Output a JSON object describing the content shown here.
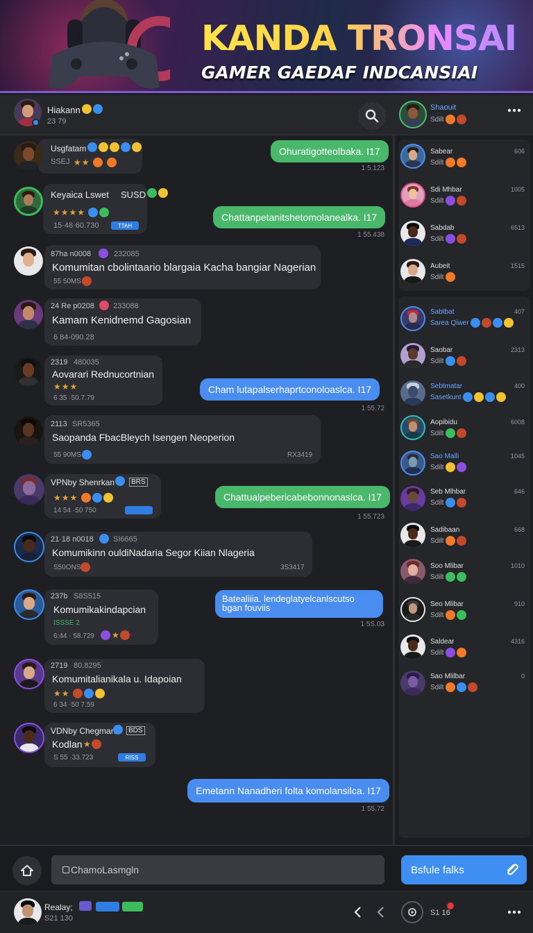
{
  "banner": {
    "title": "KANDA TRONSAI",
    "subtitle": "GAMER GAEDAF INDCANSIAI"
  },
  "topbar": {
    "user_name": "Hiakann",
    "user_meta": "23 79",
    "search_icon": "search-icon",
    "panel_user_name": "Shaouit",
    "panel_user_sub": "Sdilt",
    "more_icon": "more-icon"
  },
  "messages": [
    {
      "name": "Usgfatam",
      "meta": "SSEJ",
      "stars": "★★",
      "kind": "in"
    },
    {
      "text": "Ohuratigotteolbaka. I17",
      "time": "1 5.123",
      "kind": "out",
      "color": "green"
    },
    {
      "name": "Keyaica Lswet",
      "tag": "SUSD",
      "stars": "★★★★",
      "time": "15·48·60.730",
      "badge": "TTAH",
      "kind": "in"
    },
    {
      "text": "Chattanpetanitshetomolanealka. I17",
      "time": "1 55.438",
      "kind": "out",
      "color": "green"
    },
    {
      "name": "87ha n0008",
      "num": "232085",
      "text": "Komumitan cbolintaario blargaia Kacha bangiar Nagerian",
      "meta": "55 50MS",
      "kind": "in"
    },
    {
      "name": "24 Re p0208",
      "num": "233088",
      "text": "Kamam Kenidnemd Gagosian",
      "meta": "6 84-090.28",
      "kind": "in"
    },
    {
      "name": "2319",
      "num": "480035",
      "text": "Aovarari Rednucortnian",
      "stars": "★★★",
      "time": "6 35 ·50.7.79",
      "kind": "in"
    },
    {
      "text": "Cham lutapalserhaprtconoloaslca. I17",
      "time": "1 55.72",
      "kind": "out",
      "color": "blue"
    },
    {
      "name": "2113",
      "num": "SR5365",
      "text": "Saopanda FbacBleych Isengen Neoperion",
      "meta": "55 90MS",
      "meta_r": "RX3419",
      "kind": "in"
    },
    {
      "name": "VPNby Shenrkan",
      "tag": "BRS",
      "stars": "★★★",
      "time": "14 54 ·50 750",
      "kind": "in"
    },
    {
      "text": "Chattualpebericabebonnonaslca. I17",
      "time": "1 55.723",
      "kind": "out",
      "color": "green"
    },
    {
      "name": "21·18 n0018",
      "num": "SI6665",
      "text": "Komumikinn ouldiNadaria Segor Kiian Nlageria",
      "meta": "S50ONS",
      "meta_r": "3S3417",
      "kind": "in"
    },
    {
      "name": "237b",
      "num": "S8S515",
      "text": "Komumikakindapcian",
      "meta": "ISSSE 2",
      "time": "6:44 · 58.729",
      "kind": "in"
    },
    {
      "text": "Batealiiia. lendeglatyelcanlscutso",
      "text2": "bgan fouviis",
      "time": "1 5S.03",
      "kind": "out",
      "color": "blue"
    },
    {
      "name": "2719",
      "num": "80.8295",
      "text": "Komumitalianikala u. Idapoian",
      "stars": "★★",
      "time": "6 34 ·50 7.59",
      "kind": "in"
    },
    {
      "name": "VDNby Chegman",
      "tag": "BDS",
      "text": "Kodlan",
      "time": "S 55 ·33.723",
      "badge": "RISS",
      "kind": "in"
    },
    {
      "text": "Emetann Nanadheri folta komolansilca. I17",
      "time": "1 55.72",
      "kind": "out",
      "color": "blue"
    }
  ],
  "panel": [
    {
      "name": "Sabear",
      "sub": "Sdilt",
      "num": "606"
    },
    {
      "name": "Sdi Mhbar",
      "sub": "Sdilt",
      "num": "1005"
    },
    {
      "name": "Sabdab",
      "sub": "Sdilt",
      "num": "6513"
    },
    {
      "name": "Aubeit",
      "sub": "Sdilt",
      "num": "1515"
    },
    {
      "name": "Sabtbat",
      "sub": "Sarea Qiwer",
      "num": "407"
    },
    {
      "name": "Saobar",
      "sub": "Sdilt",
      "num": "2313"
    },
    {
      "name": "Sebtmatar",
      "sub": "Sasetkunt",
      "num": "400"
    },
    {
      "name": "Aopibidu",
      "sub": "Sdilt",
      "num": "6008"
    },
    {
      "name": "Sao Malli",
      "sub": "Sdilt",
      "num": "1045"
    },
    {
      "name": "Seb Mlhbar",
      "sub": "Sdilt",
      "num": "646"
    },
    {
      "name": "Sadibaan",
      "sub": "Sdilt",
      "num": "668"
    },
    {
      "name": "Soo Mlibar",
      "sub": "Sdilt",
      "num": "1010"
    },
    {
      "name": "Seo Mlibar",
      "sub": "Sdilt",
      "num": "910"
    },
    {
      "name": "Saldear",
      "sub": "Sdilt",
      "num": "4316"
    },
    {
      "name": "Sao Mlilbar",
      "sub": "Sdilt",
      "num": "0"
    }
  ],
  "composer": {
    "placeholder": "ChamoLasmgln",
    "send_label": "Bsfule falks"
  },
  "bottombar": {
    "user_name": "Realay;",
    "user_meta": "S21 130",
    "status_label": "S1 16"
  },
  "colors": {
    "accent_blue": "#4a8df0",
    "accent_green": "#49b86a",
    "banner_border": "#7b5bd6"
  }
}
